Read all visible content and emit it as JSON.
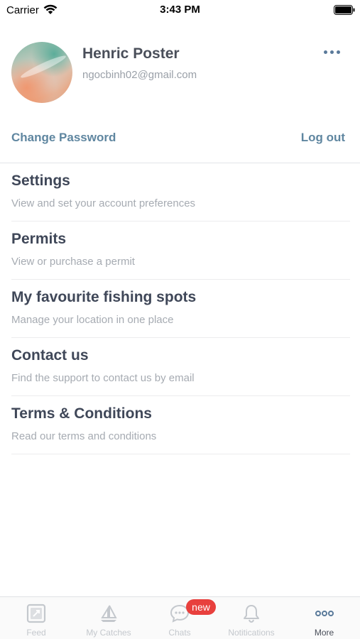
{
  "status_bar": {
    "carrier": "Carrier",
    "time": "3:43 PM",
    "icons": [
      "wifi-icon",
      "battery-icon"
    ]
  },
  "profile": {
    "name": "Henric Poster",
    "email": "ngocbinh02@gmail.com",
    "menu_icon": "more-horizontal-icon"
  },
  "account_links": {
    "change_password": "Change Password",
    "log_out": "Log out"
  },
  "menu": [
    {
      "title": "Settings",
      "subtitle": "View and set your account preferences"
    },
    {
      "title": "Permits",
      "subtitle": "View or purchase a permit"
    },
    {
      "title": "My favourite fishing spots",
      "subtitle": "Manage your location in one place"
    },
    {
      "title": "Contact us",
      "subtitle": "Find the support to contact us by email"
    },
    {
      "title": "Terms & Conditions",
      "subtitle": "Read our terms and conditions"
    }
  ],
  "tab_bar": {
    "tabs": [
      {
        "label": "Feed",
        "icon": "feed-icon",
        "active": false
      },
      {
        "label": "My Catches",
        "icon": "sailboat-icon",
        "active": false
      },
      {
        "label": "Chats",
        "icon": "chat-bubble-icon",
        "active": false,
        "badge": "new"
      },
      {
        "label": "Notitications",
        "icon": "bell-icon",
        "active": false
      },
      {
        "label": "More",
        "icon": "more-horizontal-icon",
        "active": true
      }
    ]
  },
  "colors": {
    "accent": "#5f86a0",
    "title_text": "#3f4758",
    "subtitle_text": "#a6abb2",
    "badge": "#e8403d",
    "inactive_tab": "#c4c8cd"
  }
}
